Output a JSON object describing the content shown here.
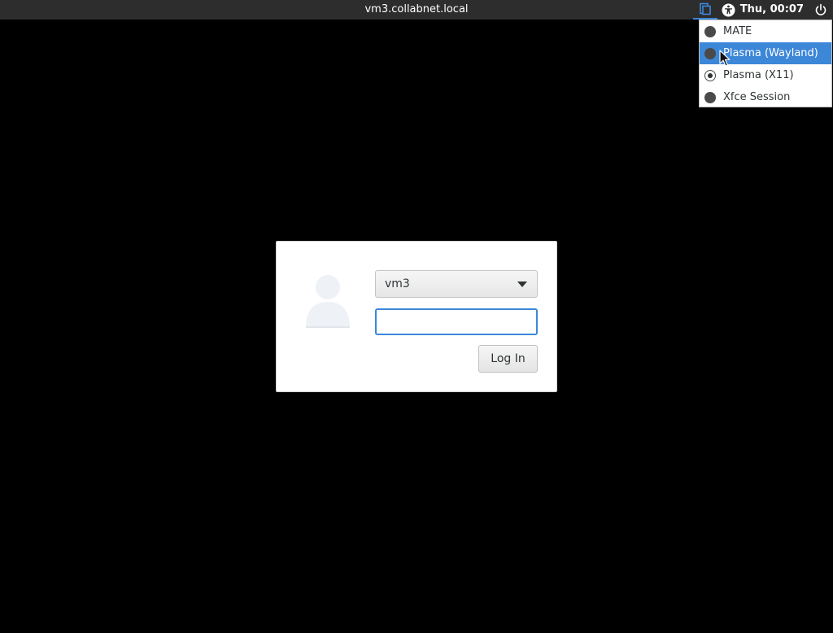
{
  "panel": {
    "hostname": "vm3.collabnet.local",
    "clock": "Thu, 00:07",
    "icons": {
      "session": "session-icon",
      "accessibility": "accessibility-icon",
      "power": "power-icon"
    },
    "accent_color": "#3c87d8"
  },
  "session_menu": {
    "items": [
      {
        "label": "MATE",
        "checked": false,
        "highlighted": false
      },
      {
        "label": "Plasma (Wayland)",
        "checked": false,
        "highlighted": true
      },
      {
        "label": "Plasma (X11)",
        "checked": true,
        "highlighted": false
      },
      {
        "label": "Xfce Session",
        "checked": false,
        "highlighted": false
      }
    ]
  },
  "login": {
    "user_selected": "vm3",
    "password_value": "",
    "login_button_label": "Log In",
    "avatar_icon": "user-avatar-icon"
  }
}
